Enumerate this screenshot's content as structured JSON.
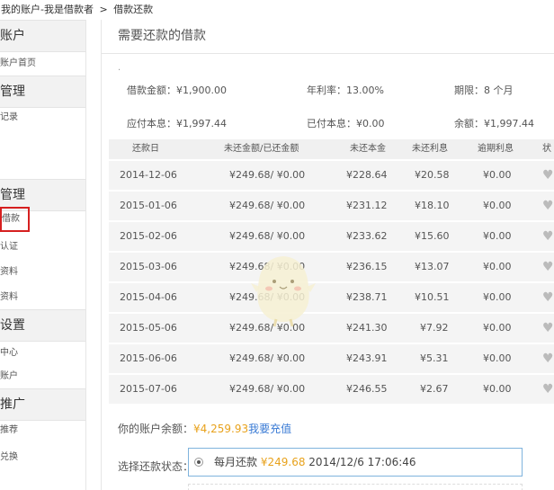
{
  "breadcrumb": {
    "parent": "我的账户-我是借款者",
    "separator": ">",
    "current": "借款还款"
  },
  "sidebar": {
    "sections": [
      {
        "label": "账户",
        "items": [
          "账户首页"
        ]
      },
      {
        "label": "管理",
        "items": [
          "记录"
        ]
      },
      {
        "label": "管理",
        "items": [
          "借款",
          "认证",
          "资料",
          "资料"
        ]
      },
      {
        "label": "设置",
        "items": [
          "中心",
          "账户"
        ]
      },
      {
        "label": "推广",
        "items": [
          "推荐",
          "兑换"
        ]
      }
    ]
  },
  "main": {
    "title": "需要还款的借款",
    "dot": ".",
    "info": {
      "loan_amount": "借款金额：¥1,900.00",
      "annual_rate": "年利率：13.00%",
      "term": "期限：8 个月",
      "total_due": "应付本息：¥1,997.44",
      "paid": "已付本息：¥0.00",
      "remaining": "余额：¥1,997.44"
    },
    "table": {
      "headers": [
        "还款日",
        "未还金额/已还金额",
        "未还本金",
        "未还利息",
        "逾期利息",
        "状"
      ],
      "rows": [
        [
          "2014-12-06",
          "¥249.68/ ¥0.00",
          "¥228.64",
          "¥20.58",
          "¥0.00"
        ],
        [
          "2015-01-06",
          "¥249.68/ ¥0.00",
          "¥231.12",
          "¥18.10",
          "¥0.00"
        ],
        [
          "2015-02-06",
          "¥249.68/ ¥0.00",
          "¥233.62",
          "¥15.60",
          "¥0.00"
        ],
        [
          "2015-03-06",
          "¥249.68/ ¥0.00",
          "¥236.15",
          "¥13.07",
          "¥0.00"
        ],
        [
          "2015-04-06",
          "¥249.68/ ¥0.00",
          "¥238.71",
          "¥10.51",
          "¥0.00"
        ],
        [
          "2015-05-06",
          "¥249.68/ ¥0.00",
          "¥241.30",
          "¥7.92",
          "¥0.00"
        ],
        [
          "2015-06-06",
          "¥249.68/ ¥0.00",
          "¥243.91",
          "¥5.31",
          "¥0.00"
        ],
        [
          "2015-07-06",
          "¥249.68/ ¥0.00",
          "¥246.55",
          "¥2.67",
          "¥0.00"
        ]
      ]
    },
    "balance": {
      "label": "你的账户余额：",
      "amount": "¥4,259.93",
      "recharge_link": "我要充值"
    },
    "repay_status": {
      "label": "选择还款状态：",
      "option_label": "每月还款",
      "option_amount": "¥249.68",
      "option_datetime": "2014/12/6 17:06:46"
    }
  },
  "colors": {
    "accent_amount": "#e8a21c",
    "link": "#3a7bd5",
    "active_border": "#d62020",
    "input_border": "#7fb3dd"
  }
}
